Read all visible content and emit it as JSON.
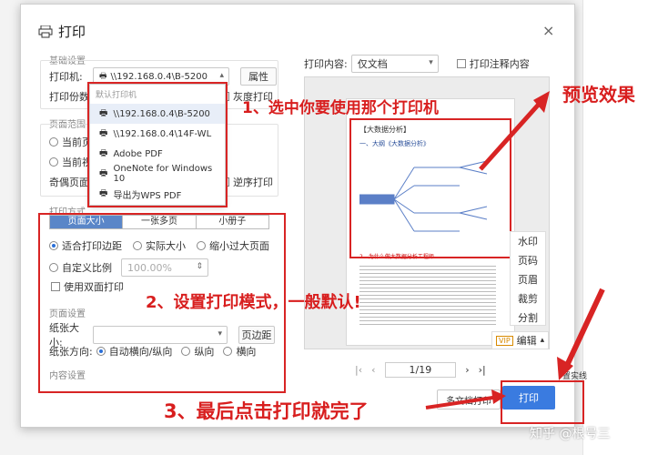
{
  "dialog": {
    "title": "打印",
    "close": "×"
  },
  "basic": {
    "section": "基础设置",
    "printer_label": "打印机:",
    "printer_value": "\\\\192.168.0.4\\B-5200",
    "props_button": "属性",
    "copies_label": "打印份数:",
    "gray_label": "灰度打印"
  },
  "dropdown": {
    "header": "默认打印机",
    "items": [
      "\\\\192.168.0.4\\B-5200",
      "\\\\192.168.0.4\\14F-WL",
      "Adobe PDF",
      "OneNote for Windows 10",
      "导出为WPS PDF"
    ]
  },
  "range": {
    "section": "页面范围",
    "opt1": "当前页面",
    "opt2": "当前视图",
    "odd_label": "奇偶页面:",
    "reverse_label": "逆序打印"
  },
  "mode": {
    "section": "打印方式",
    "tabs": [
      "页面大小",
      "一张多页",
      "小册子"
    ],
    "fit": "适合打印边距",
    "actual": "实际大小",
    "shrink": "缩小过大页面",
    "custom": "自定义比例",
    "custom_value": "100.00%",
    "duplex": "使用双面打印"
  },
  "page_setup": {
    "section": "页面设置",
    "paper_label": "纸张大小:",
    "margin_button": "页边距",
    "orient_label": "纸张方向:",
    "auto": "自动横向/纵向",
    "portrait": "纵向",
    "landscape": "横向"
  },
  "content_section": "内容设置",
  "preview": {
    "content_label": "打印内容:",
    "content_value": "仅文档",
    "annotate_label": "打印注释内容",
    "doc_title": "【大数据分析】",
    "doc_h1": "一、大纲《大数据分析》",
    "doc_line": "2、为什么做大数据分析工程师",
    "page_indicator": "1/19",
    "side_menu": [
      "水印",
      "页码",
      "页眉",
      "裁剪",
      "分割"
    ],
    "edit_label": "编辑",
    "vip": "VIP"
  },
  "footer": {
    "multi_print": "多文档打印",
    "print": "打印",
    "hint": "置实线"
  },
  "annotations": {
    "a1": "1、选中你要使用那个打印机",
    "a2": "2、设置打印模式，一般默认!",
    "a3": "3、最后点击打印就完了",
    "preview": "预览效果"
  },
  "watermark": "知乎 @根号三"
}
